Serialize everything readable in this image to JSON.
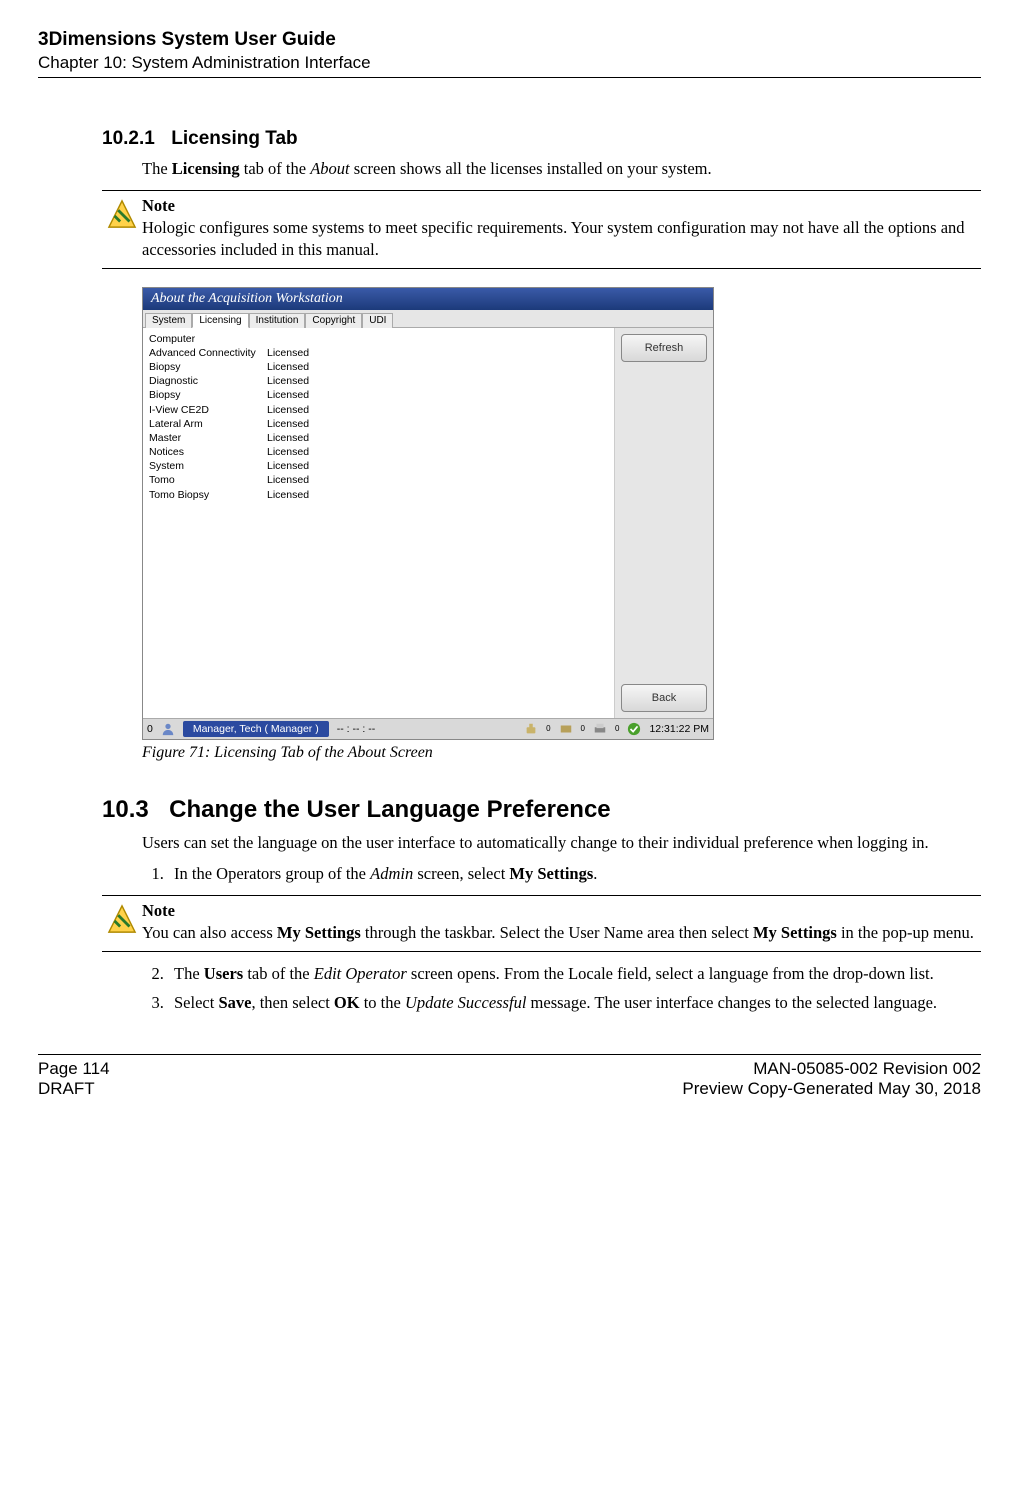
{
  "header": {
    "title": "3Dimensions System User Guide",
    "chapter": "Chapter 10: System Administration Interface"
  },
  "section_10_2_1": {
    "number": "10.2.1",
    "title": "Licensing Tab",
    "intro_pre": "The ",
    "intro_bold": "Licensing",
    "intro_mid": " tab of the ",
    "intro_ital": "About",
    "intro_post": " screen shows all the licenses installed on your system."
  },
  "note1": {
    "label": "Note",
    "body": "Hologic configures some systems to meet specific requirements. Your system configuration may not have all the options and accessories included in this manual."
  },
  "screenshot": {
    "window_title": "About the Acquisition Workstation",
    "tabs": [
      "System",
      "Licensing",
      "Institution",
      "Copyright",
      "UDI"
    ],
    "active_tab_index": 1,
    "rows": [
      {
        "name": "Computer",
        "status": ""
      },
      {
        "name": "Advanced Connectivity",
        "status": "Licensed"
      },
      {
        "name": "Biopsy",
        "status": "Licensed"
      },
      {
        "name": "Diagnostic",
        "status": "Licensed"
      },
      {
        "name": "Biopsy",
        "status": "Licensed"
      },
      {
        "name": "I-View CE2D",
        "status": "Licensed"
      },
      {
        "name": "Lateral Arm",
        "status": "Licensed"
      },
      {
        "name": "Master",
        "status": "Licensed"
      },
      {
        "name": "Notices",
        "status": "Licensed"
      },
      {
        "name": "System",
        "status": "Licensed"
      },
      {
        "name": "Tomo",
        "status": "Licensed"
      },
      {
        "name": "Tomo Biopsy",
        "status": "Licensed"
      }
    ],
    "buttons": {
      "refresh": "Refresh",
      "back": "Back"
    },
    "statusbar": {
      "left_num": "0",
      "user": "Manager, Tech ( Manager )",
      "dashes": "-- : -- : --",
      "zero": "0",
      "time": "12:31:22 PM"
    }
  },
  "figure_caption": "Figure 71: Licensing Tab of the About Screen",
  "section_10_3": {
    "number": "10.3",
    "title": "Change the User Language Preference",
    "intro": "Users can set the language on the user interface to automatically change to their individual preference when logging in.",
    "step1_pre": "In the Operators group of the ",
    "step1_ital": "Admin",
    "step1_mid": " screen, select ",
    "step1_bold": "My Settings",
    "step1_post": "."
  },
  "note2": {
    "label": "Note",
    "b_pre": "You can also access ",
    "b_bold1": "My Settings",
    "b_mid": " through the taskbar. Select the User Name area then select ",
    "b_bold2": "My Settings",
    "b_post": " in the pop-up menu."
  },
  "steps_continued": {
    "s2_pre": "The ",
    "s2_bold": "Users",
    "s2_mid": " tab of the ",
    "s2_ital": "Edit Operator",
    "s2_post": " screen opens. From the Locale field, select a language from the drop-down list.",
    "s3_pre": "Select ",
    "s3_bold1": "Save",
    "s3_mid1": ", then select ",
    "s3_bold2": "OK",
    "s3_mid2": " to the ",
    "s3_ital": "Update Successful",
    "s3_post": " message. The user interface changes to the selected language."
  },
  "footer": {
    "page": "Page 114",
    "draft": "DRAFT",
    "rev": "MAN-05085-002 Revision 002",
    "gen": "Preview Copy-Generated May 30, 2018"
  }
}
